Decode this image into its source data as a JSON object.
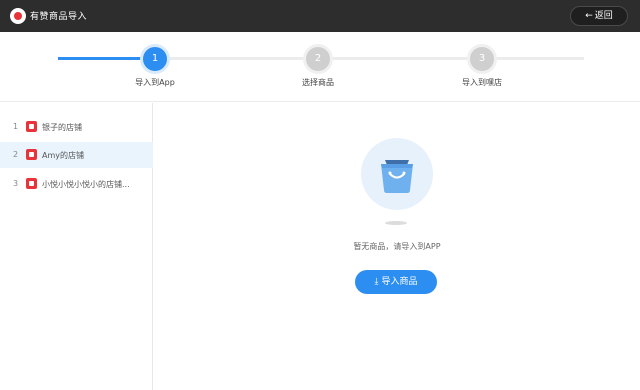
{
  "header": {
    "title": "有赞商品导入",
    "back_label": "返回",
    "back_icon": "arrow-left-icon",
    "background": "#2d2d2d"
  },
  "steps": [
    {
      "number": "1",
      "label": "导入到App",
      "state": "active"
    },
    {
      "number": "2",
      "label": "选择商品",
      "state": "pending"
    },
    {
      "number": "3",
      "label": "导入到嘿店",
      "state": "pending"
    }
  ],
  "sidebar": {
    "items": [
      {
        "index": "1",
        "name": "银子的店铺",
        "selected": false
      },
      {
        "index": "2",
        "name": "Amy的店铺",
        "selected": true
      },
      {
        "index": "3",
        "name": "小悦小悦小悦小的店铺...",
        "selected": false
      }
    ]
  },
  "main": {
    "empty_text": "暂无商品，请导入到APP",
    "import_label": "导入商品",
    "import_icon": "download-icon"
  },
  "colors": {
    "accent": "#2c8ef0",
    "brand_red": "#e8333a",
    "selected_row": "#e9f4fd"
  }
}
